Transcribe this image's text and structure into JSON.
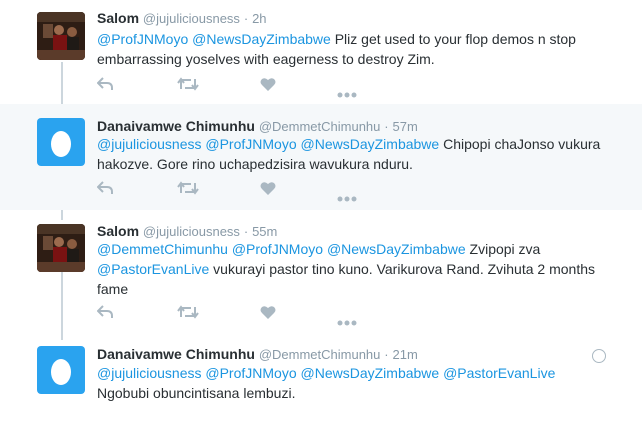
{
  "tweets": [
    {
      "name": "Salom",
      "handle": "@jujuliciousness",
      "sep": "·",
      "time": "2h",
      "text": [
        {
          "t": "@ProfJNMoyo",
          "m": true
        },
        {
          "t": " ",
          "m": false
        },
        {
          "t": "@NewsDayZimbabwe",
          "m": true
        },
        {
          "t": " Pliz get used to your flop demos n stop embarrassing yoselves with eagerness to destroy Zim.",
          "m": false
        }
      ]
    },
    {
      "name": "Danaivamwe Chimunhu",
      "handle": "@DemmetChimunhu",
      "sep": "·",
      "time": "57m",
      "text": [
        {
          "t": "@jujuliciousness",
          "m": true
        },
        {
          "t": " ",
          "m": false
        },
        {
          "t": "@ProfJNMoyo",
          "m": true
        },
        {
          "t": " ",
          "m": false
        },
        {
          "t": "@NewsDayZimbabwe",
          "m": true
        },
        {
          "t": " Chipopi chaJonso vukura hakozve. Gore rino uchapedzisira wavukura nduru.",
          "m": false
        }
      ]
    },
    {
      "name": "Salom",
      "handle": "@jujuliciousness",
      "sep": "·",
      "time": "55m",
      "text": [
        {
          "t": "@DemmetChimunhu",
          "m": true
        },
        {
          "t": " ",
          "m": false
        },
        {
          "t": "@ProfJNMoyo",
          "m": true
        },
        {
          "t": " ",
          "m": false
        },
        {
          "t": "@NewsDayZimbabwe",
          "m": true
        },
        {
          "t": " Zvipopi zva ",
          "m": false
        },
        {
          "t": "@PastorEvanLive",
          "m": true
        },
        {
          "t": " vukurayi pastor tino kuno. Varikurova Rand. Zvihuta 2 months fame",
          "m": false
        }
      ]
    },
    {
      "name": "Danaivamwe Chimunhu",
      "handle": "@DemmetChimunhu",
      "sep": "·",
      "time": "21m",
      "text": [
        {
          "t": "@jujuliciousness",
          "m": true
        },
        {
          "t": " ",
          "m": false
        },
        {
          "t": "@ProfJNMoyo",
          "m": true
        },
        {
          "t": " ",
          "m": false
        },
        {
          "t": "@NewsDayZimbabwe",
          "m": true
        },
        {
          "t": " ",
          "m": false
        },
        {
          "t": "@PastorEvanLive",
          "m": true
        },
        {
          "t": " Ngobubi obuncintisana lembuzi.",
          "m": false
        }
      ]
    }
  ],
  "actions": {
    "reply_icon": "reply-icon",
    "retweet_icon": "retweet-icon",
    "like_icon": "heart-icon",
    "more_icon": "more-icon"
  },
  "colors": {
    "mention": "#1b95e0",
    "egg_avatar": "#2aa3ef",
    "thread_line": "#ccd6dd",
    "highlight_bg": "#f5f8fa",
    "muted": "#8899a6"
  }
}
